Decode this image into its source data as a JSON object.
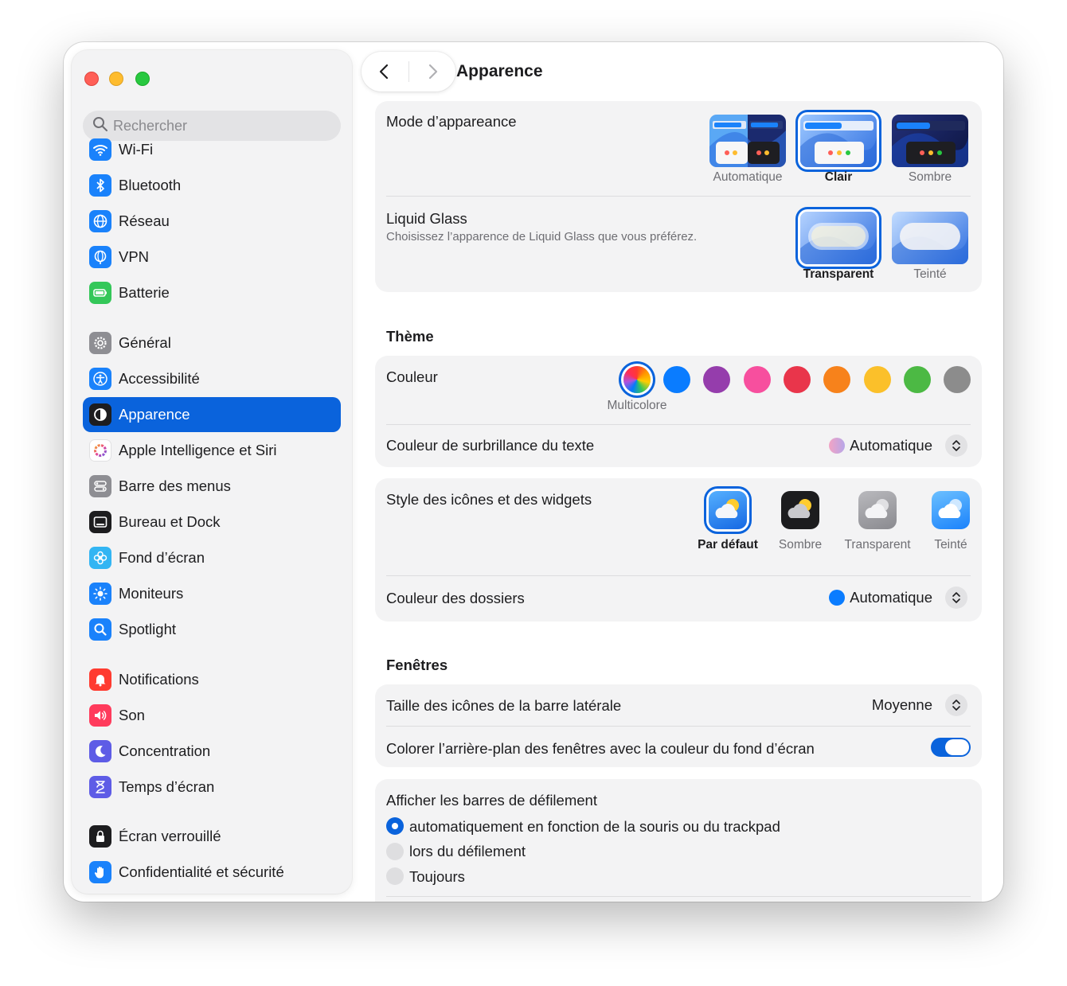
{
  "window": {
    "title": "Apparence"
  },
  "sidebar": {
    "search_placeholder": "Rechercher",
    "items": [
      {
        "label": "Wi-Fi",
        "icon": "wifi-icon",
        "color": "#1a82fb"
      },
      {
        "label": "Bluetooth",
        "icon": "bluetooth-icon",
        "color": "#1a82fb"
      },
      {
        "label": "Réseau",
        "icon": "globe-icon",
        "color": "#1a82fb"
      },
      {
        "label": "VPN",
        "icon": "vpn-globe-icon",
        "color": "#1a82fb"
      },
      {
        "label": "Batterie",
        "icon": "battery-icon",
        "color": "#34c759"
      },
      {
        "label": "Général",
        "icon": "gear-icon",
        "color": "#8e8e93"
      },
      {
        "label": "Accessibilité",
        "icon": "accessibility-icon",
        "color": "#1a82fb"
      },
      {
        "label": "Apparence",
        "icon": "appearance-icon",
        "color": "#1d1d1f",
        "active": true
      },
      {
        "label": "Apple Intelligence et Siri",
        "icon": "siri-icon",
        "color": "#e86fa8"
      },
      {
        "label": "Barre des menus",
        "icon": "menubar-icon",
        "color": "#8e8e93"
      },
      {
        "label": "Bureau et Dock",
        "icon": "dock-icon",
        "color": "#1d1d1f"
      },
      {
        "label": "Fond d’écran",
        "icon": "wallpaper-icon",
        "color": "#32b5f3"
      },
      {
        "label": "Moniteurs",
        "icon": "brightness-icon",
        "color": "#1a82fb"
      },
      {
        "label": "Spotlight",
        "icon": "magnifier-icon",
        "color": "#1a82fb"
      },
      {
        "label": "Notifications",
        "icon": "bell-icon",
        "color": "#ff3b30"
      },
      {
        "label": "Son",
        "icon": "speaker-icon",
        "color": "#ff3b5c"
      },
      {
        "label": "Concentration",
        "icon": "moon-icon",
        "color": "#5e5ce6"
      },
      {
        "label": "Temps d’écran",
        "icon": "hourglass-icon",
        "color": "#5e5ce6"
      },
      {
        "label": "Écran verrouillé",
        "icon": "lock-icon",
        "color": "#1d1d1f"
      },
      {
        "label": "Confidentialité et sécurité",
        "icon": "hand-icon",
        "color": "#1a82fb"
      }
    ]
  },
  "header": {
    "title": "Apparence"
  },
  "appearance_mode": {
    "label": "Mode d’appareance",
    "options": [
      {
        "label": "Automatique",
        "selected": false
      },
      {
        "label": "Clair",
        "selected": true
      },
      {
        "label": "Sombre",
        "selected": false
      }
    ]
  },
  "liquid_glass": {
    "label": "Liquid Glass",
    "description": "Choisissez l’apparence de Liquid Glass que vous préférez.",
    "options": [
      {
        "label": "Transparent",
        "selected": true
      },
      {
        "label": "Teinté",
        "selected": false
      }
    ]
  },
  "theme": {
    "section_title": "Thème",
    "color_label": "Couleur",
    "selected_color_caption": "Multicolore",
    "colors": [
      "multicolor",
      "#0a7cff",
      "#953dac",
      "#f74f9e",
      "#e9354b",
      "#f7821b",
      "#fbc02a",
      "#4cb944",
      "#8c8c8c"
    ],
    "highlight_label": "Couleur de surbrillance du texte",
    "highlight_value": "Automatique"
  },
  "icons_widgets": {
    "label": "Style des icônes et des widgets",
    "options": [
      {
        "label": "Par défaut",
        "selected": true
      },
      {
        "label": "Sombre",
        "selected": false
      },
      {
        "label": "Transparent",
        "selected": false
      },
      {
        "label": "Teinté",
        "selected": false
      }
    ],
    "folder_color_label": "Couleur des dossiers",
    "folder_color_value": "Automatique"
  },
  "windows": {
    "section_title": "Fenêtres",
    "sidebar_icon_size_label": "Taille des icônes de la barre latérale",
    "sidebar_icon_size_value": "Moyenne",
    "tint_label": "Colorer l’arrière-plan des fenêtres avec la couleur du fond d’écran",
    "tint_enabled": true
  },
  "scrollbars": {
    "label": "Afficher les barres de défilement",
    "options": [
      {
        "label": "automatiquement en fonction de la souris ou du trackpad",
        "selected": true
      },
      {
        "label": "lors du défilement",
        "selected": false
      },
      {
        "label": "Toujours",
        "selected": false
      }
    ]
  }
}
